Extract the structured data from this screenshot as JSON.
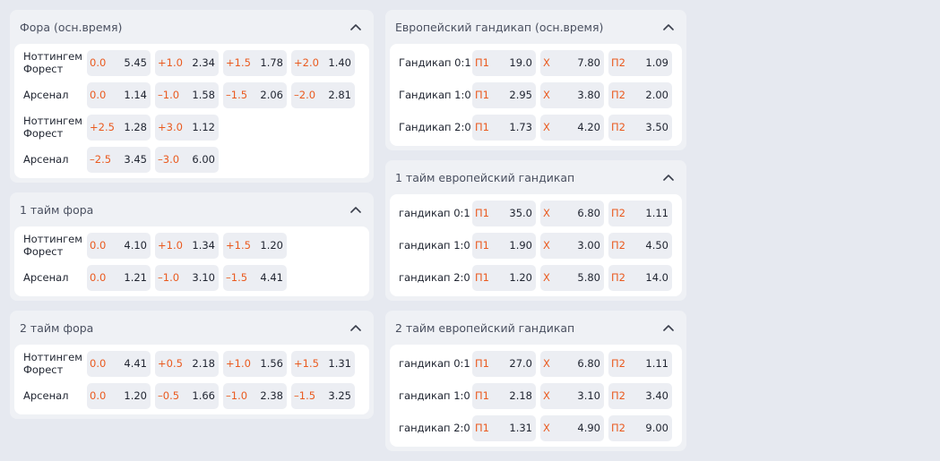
{
  "left": [
    {
      "title": "Фора (осн.время)",
      "rows": [
        {
          "team": "Ноттингем Форест",
          "cells": [
            [
              "0.0",
              "5.45"
            ],
            [
              "+1.0",
              "2.34"
            ],
            [
              "+1.5",
              "1.78"
            ],
            [
              "+2.0",
              "1.40"
            ]
          ]
        },
        {
          "team": "Арсенал",
          "cells": [
            [
              "0.0",
              "1.14"
            ],
            [
              "–1.0",
              "1.58"
            ],
            [
              "–1.5",
              "2.06"
            ],
            [
              "–2.0",
              "2.81"
            ]
          ]
        },
        {
          "team": "Ноттингем Форест",
          "cells": [
            [
              "+2.5",
              "1.28"
            ],
            [
              "+3.0",
              "1.12"
            ]
          ]
        },
        {
          "team": "Арсенал",
          "cells": [
            [
              "–2.5",
              "3.45"
            ],
            [
              "–3.0",
              "6.00"
            ]
          ]
        }
      ]
    },
    {
      "title": "1 тайм фора",
      "rows": [
        {
          "team": "Ноттингем Форест",
          "cells": [
            [
              "0.0",
              "4.10"
            ],
            [
              "+1.0",
              "1.34"
            ],
            [
              "+1.5",
              "1.20"
            ]
          ]
        },
        {
          "team": "Арсенал",
          "cells": [
            [
              "0.0",
              "1.21"
            ],
            [
              "–1.0",
              "3.10"
            ],
            [
              "–1.5",
              "4.41"
            ]
          ]
        }
      ]
    },
    {
      "title": "2 тайм фора",
      "rows": [
        {
          "team": "Ноттингем Форест",
          "cells": [
            [
              "0.0",
              "4.41"
            ],
            [
              "+0.5",
              "2.18"
            ],
            [
              "+1.0",
              "1.56"
            ],
            [
              "+1.5",
              "1.31"
            ]
          ]
        },
        {
          "team": "Арсенал",
          "cells": [
            [
              "0.0",
              "1.20"
            ],
            [
              "–0.5",
              "1.66"
            ],
            [
              "–1.0",
              "2.38"
            ],
            [
              "–1.5",
              "3.25"
            ]
          ]
        }
      ]
    }
  ],
  "right": [
    {
      "title": "Европейский гандикап (осн.время)",
      "rows": [
        {
          "team": "Гандикап 0:1",
          "cells": [
            [
              "П1",
              "19.0"
            ],
            [
              "Х",
              "7.80"
            ],
            [
              "П2",
              "1.09"
            ]
          ]
        },
        {
          "team": "Гандикап 1:0",
          "cells": [
            [
              "П1",
              "2.95"
            ],
            [
              "Х",
              "3.80"
            ],
            [
              "П2",
              "2.00"
            ]
          ]
        },
        {
          "team": "Гандикап 2:0",
          "cells": [
            [
              "П1",
              "1.73"
            ],
            [
              "Х",
              "4.20"
            ],
            [
              "П2",
              "3.50"
            ]
          ]
        }
      ]
    },
    {
      "title": "1 тайм европейский гандикап",
      "rows": [
        {
          "team": "гандикап 0:1",
          "cells": [
            [
              "П1",
              "35.0"
            ],
            [
              "Х",
              "6.80"
            ],
            [
              "П2",
              "1.11"
            ]
          ]
        },
        {
          "team": "гандикап 1:0",
          "cells": [
            [
              "П1",
              "1.90"
            ],
            [
              "Х",
              "3.00"
            ],
            [
              "П2",
              "4.50"
            ]
          ]
        },
        {
          "team": "гандикап 2:0",
          "cells": [
            [
              "П1",
              "1.20"
            ],
            [
              "Х",
              "5.80"
            ],
            [
              "П2",
              "14.0"
            ]
          ]
        }
      ]
    },
    {
      "title": "2 тайм европейский гандикап",
      "rows": [
        {
          "team": "гандикап 0:1",
          "cells": [
            [
              "П1",
              "27.0"
            ],
            [
              "Х",
              "6.80"
            ],
            [
              "П2",
              "1.11"
            ]
          ]
        },
        {
          "team": "гандикап 1:0",
          "cells": [
            [
              "П1",
              "2.18"
            ],
            [
              "Х",
              "3.10"
            ],
            [
              "П2",
              "3.40"
            ]
          ]
        },
        {
          "team": "гандикап 2:0",
          "cells": [
            [
              "П1",
              "1.31"
            ],
            [
              "Х",
              "4.90"
            ],
            [
              "П2",
              "9.00"
            ]
          ]
        }
      ]
    }
  ],
  "colors": {
    "odds_label": "#ea5a1f",
    "panel_bg": "#eff1f5",
    "cell_bg": "#eceef3",
    "page_bg": "#e6e9f0"
  },
  "icons": {
    "collapse": "chevron-up-icon"
  }
}
